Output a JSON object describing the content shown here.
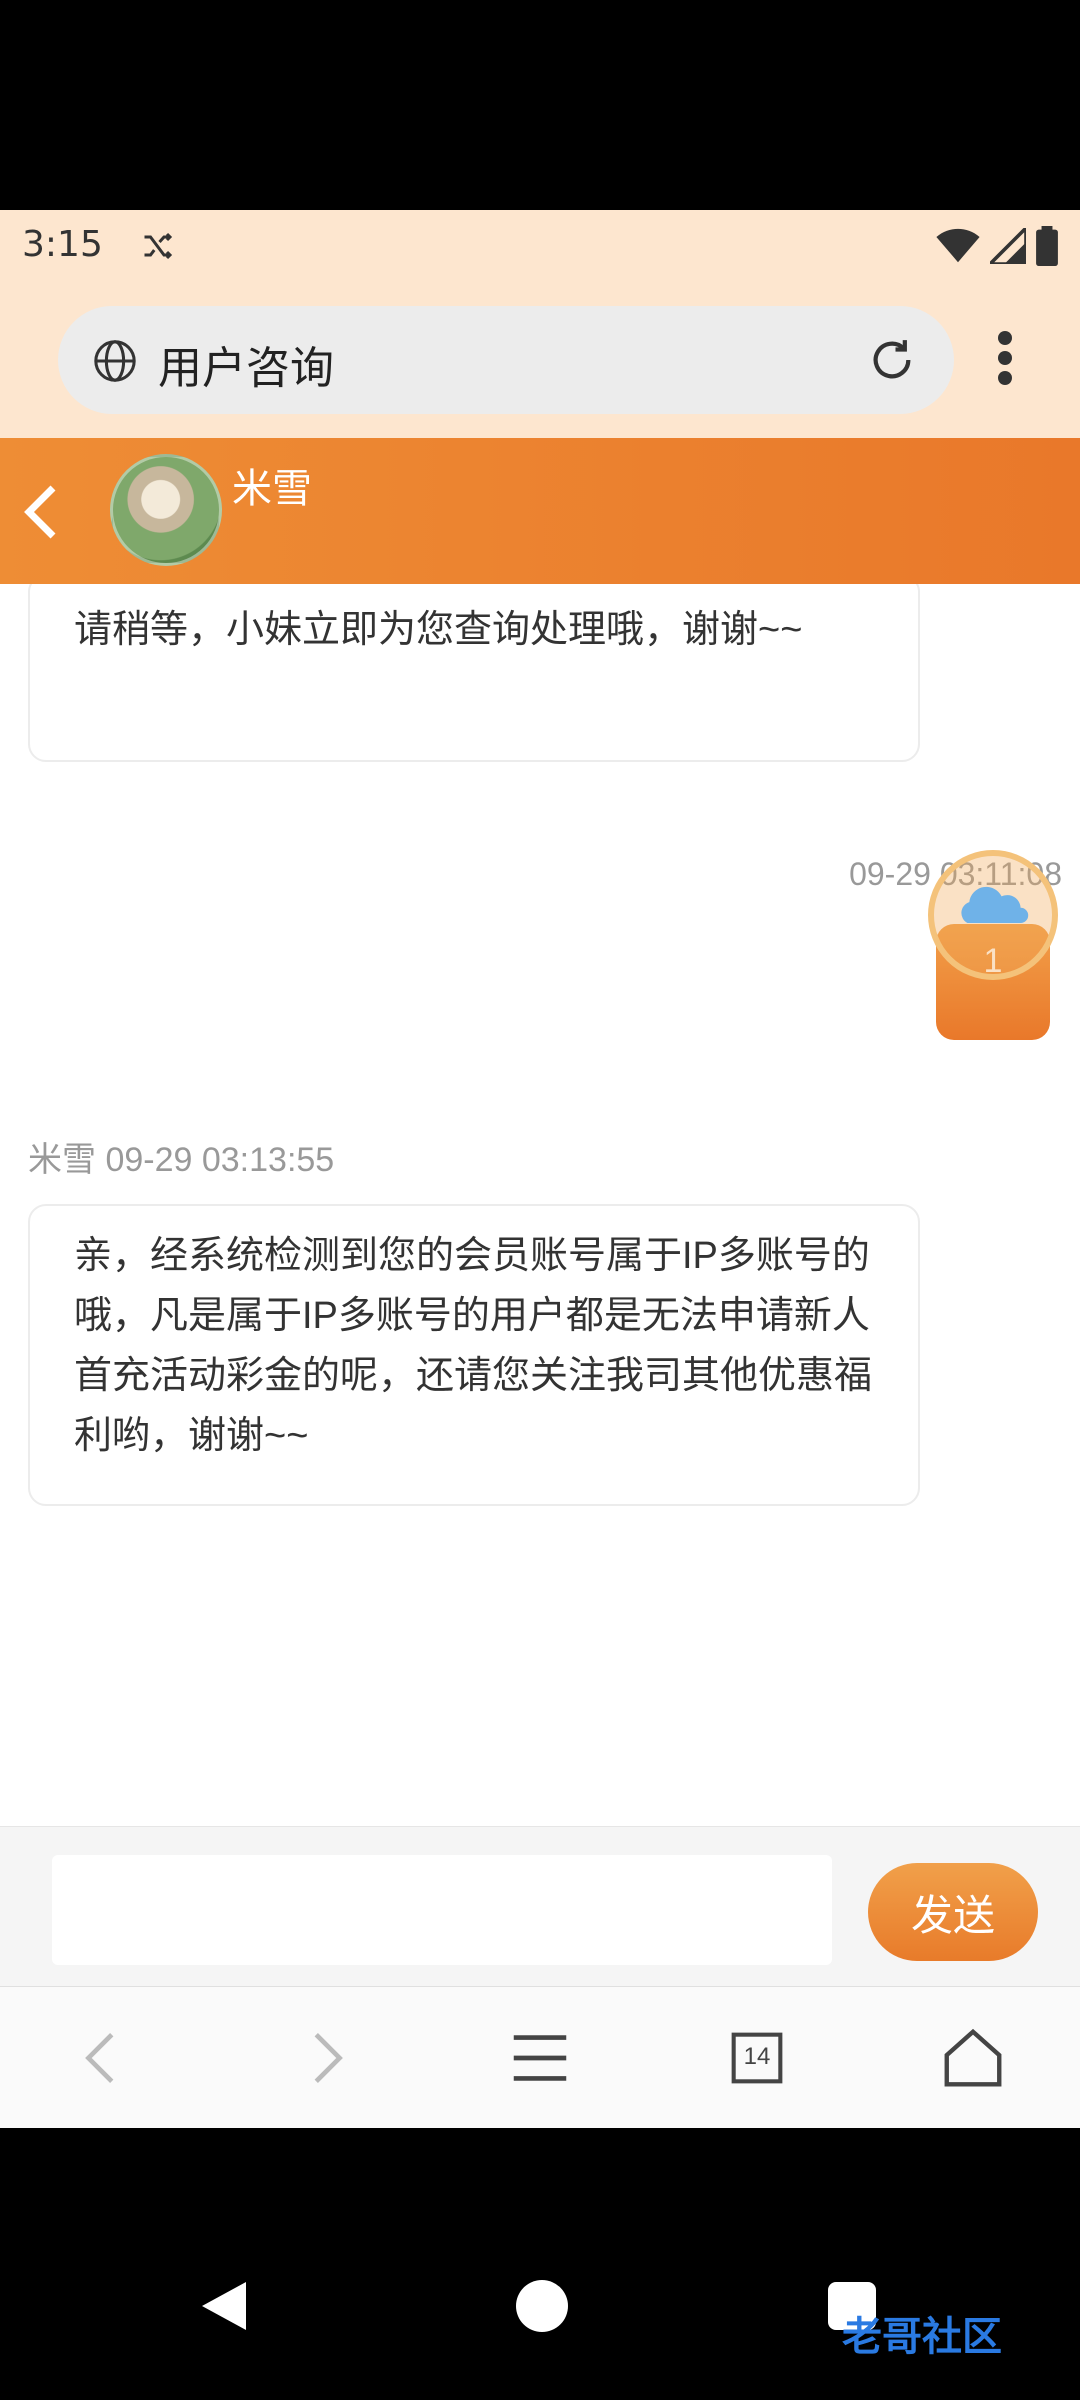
{
  "status_bar": {
    "time": "3:15",
    "icons": [
      "shuffle-icon",
      "wifi-icon",
      "signal-icon",
      "battery-icon"
    ]
  },
  "browser": {
    "page_title": "用户咨询",
    "icons": [
      "globe-icon",
      "reload-icon",
      "more-vert-icon"
    ]
  },
  "chat_header": {
    "contact_name": "米雪",
    "back_icon": "chevron-left-icon"
  },
  "messages": [
    {
      "side": "left",
      "text": "请稍等，小妹立即为您查询处理哦，谢谢~~"
    },
    {
      "side": "right",
      "timestamp": "09-29 03:11:08"
    },
    {
      "side": "left",
      "sender": "米雪",
      "timestamp": "09-29 03:13:55",
      "text": "亲，经系统检测到您的会员账号属于IP多账号的哦，凡是属于IP多账号的用户都是无法申请新人首充活动彩金的呢，还请您关注我司其他优惠福利哟，谢谢~~"
    }
  ],
  "floating_widget": {
    "count": "1"
  },
  "composer": {
    "tools": [
      "image-icon",
      "video-icon",
      "emoji-icon"
    ],
    "input_value": "",
    "send_label": "发送"
  },
  "browser_nav": {
    "tab_count": "14",
    "items": [
      "back-icon",
      "forward-icon",
      "menu-icon",
      "tabs-icon",
      "home-icon"
    ]
  },
  "watermark": {
    "text": "老哥社区"
  },
  "colors": {
    "accent": "#e9782a",
    "status_bg": "#fde6cf",
    "bubble_border": "#ececec"
  }
}
